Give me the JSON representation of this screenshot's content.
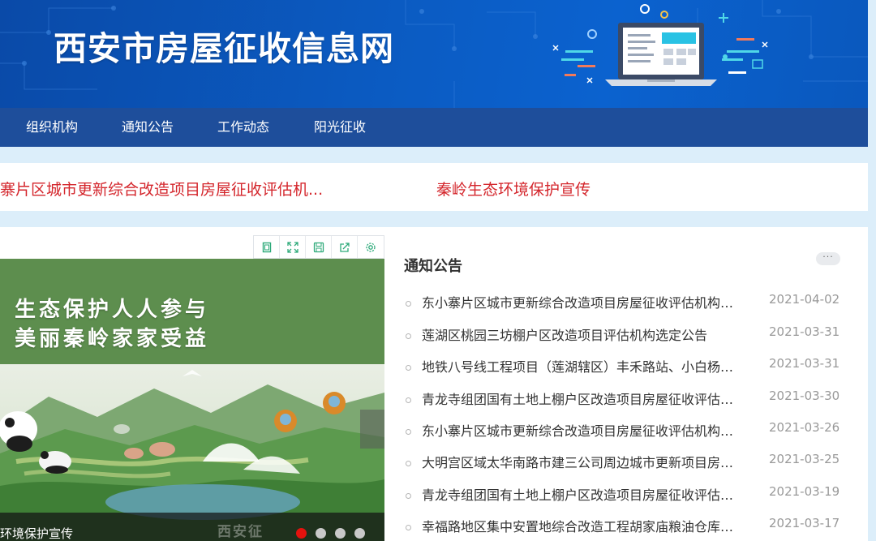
{
  "header": {
    "site_title": "西安市房屋征收信息网"
  },
  "nav": {
    "items": [
      {
        "label": "组织机构"
      },
      {
        "label": "通知公告"
      },
      {
        "label": "工作动态"
      },
      {
        "label": "阳光征收"
      }
    ]
  },
  "headlines": [
    {
      "text": "寨片区城市更新综合改造项目房屋征收评估机..."
    },
    {
      "text": "秦岭生态环境保护宣传"
    }
  ],
  "slider": {
    "toolbar_icons": [
      "fit-page-icon",
      "fullscreen-icon",
      "save-icon",
      "share-icon",
      "settings-icon"
    ],
    "slogan_line1": "生态保护人人参与",
    "slogan_line2": "美丽秦岭家家受益",
    "caption": "环境保护宣传",
    "watermark": "西安征",
    "dots": [
      {
        "active": true
      },
      {
        "active": false
      },
      {
        "active": false
      },
      {
        "active": false
      }
    ],
    "active_dot_color": "#e4120e"
  },
  "notice": {
    "title": "通知公告",
    "more_label": "···",
    "items": [
      {
        "text": "东小寨片区城市更新综合改造项目房屋征收评估机构选定公告",
        "date": "2021-04-02"
      },
      {
        "text": "莲湖区桃园三坊棚户区改造项目评估机构选定公告",
        "date": "2021-03-31"
      },
      {
        "text": "地铁八号线工程项目（莲湖辖区）丰禾路站、小白杨路站",
        "date": "2021-03-31"
      },
      {
        "text": "青龙寺组团国有土地上棚户区改造项目房屋征收评估机构",
        "date": "2021-03-30"
      },
      {
        "text": "东小寨片区城市更新综合改造项目房屋征收评估机构报名",
        "date": "2021-03-26"
      },
      {
        "text": "大明宫区域太华南路市建三公司周边城市更新项目房屋征",
        "date": "2021-03-25"
      },
      {
        "text": "青龙寺组团国有土地上棚户区改造项目房屋征收评估机构",
        "date": "2021-03-19"
      },
      {
        "text": "幸福路地区集中安置地综合改造工程胡家庙粮油仓库项目",
        "date": "2021-03-17"
      }
    ]
  },
  "colors": {
    "header_blue": "#0b5bc2",
    "nav_blue": "#1e4e9b",
    "headline_red": "#d4262c",
    "page_bg": "#dceefa"
  }
}
